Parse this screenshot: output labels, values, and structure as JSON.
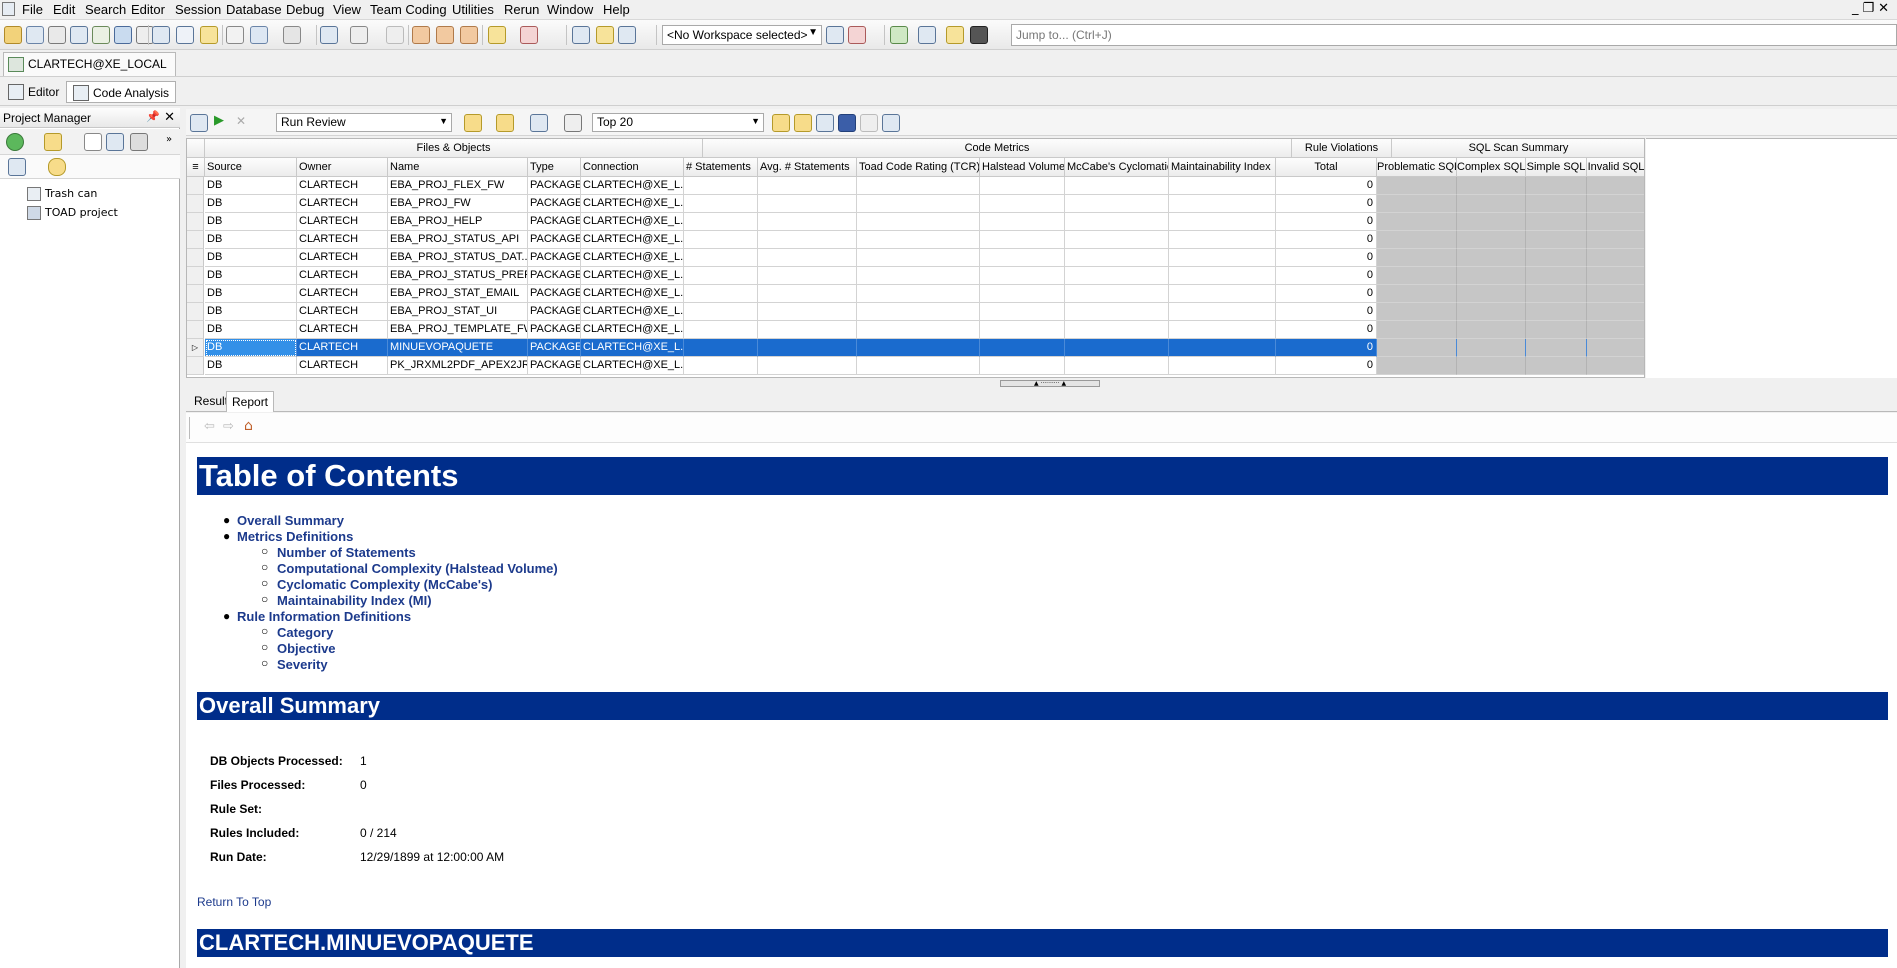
{
  "menu": [
    "File",
    "Edit",
    "Search",
    "Editor",
    "Session",
    "Database",
    "Debug",
    "View",
    "Team Coding",
    "Utilities",
    "Rerun",
    "Window",
    "Help"
  ],
  "toolbar": {
    "workspace": "<No Workspace selected>",
    "jump_placeholder": "Jump to... (Ctrl+J)"
  },
  "connection_tab": "CLARTECH@XE_LOCAL",
  "editor_tabs": [
    "Editor",
    "Code Analysis"
  ],
  "project_manager": {
    "title": "Project Manager",
    "items": [
      "Trash can",
      "TOAD project"
    ]
  },
  "review_toolbar": {
    "action": "Run Review",
    "top": "Top 20"
  },
  "grid": {
    "groups": [
      "Files & Objects",
      "Code Metrics",
      "Rule Violations",
      "SQL Scan Summary"
    ],
    "columns": [
      "Source",
      "Owner",
      "Name",
      "Type",
      "Connection",
      "# Statements",
      "Avg. # Statements",
      "Toad Code Rating (TCR)",
      "Halstead Volume",
      "McCabe's Cyclomatic",
      "Maintainability Index",
      "Total",
      "Problematic SQL",
      "Complex SQL",
      "Simple SQL",
      "Invalid SQL"
    ],
    "rows": [
      {
        "source": "DB",
        "owner": "CLARTECH",
        "name": "EBA_PROJ_FLEX_FW",
        "type": "PACKAGE",
        "conn": "CLARTECH@XE_L...",
        "total": "0"
      },
      {
        "source": "DB",
        "owner": "CLARTECH",
        "name": "EBA_PROJ_FW",
        "type": "PACKAGE",
        "conn": "CLARTECH@XE_L...",
        "total": "0"
      },
      {
        "source": "DB",
        "owner": "CLARTECH",
        "name": "EBA_PROJ_HELP",
        "type": "PACKAGE",
        "conn": "CLARTECH@XE_L...",
        "total": "0"
      },
      {
        "source": "DB",
        "owner": "CLARTECH",
        "name": "EBA_PROJ_STATUS_API",
        "type": "PACKAGE",
        "conn": "CLARTECH@XE_L...",
        "total": "0"
      },
      {
        "source": "DB",
        "owner": "CLARTECH",
        "name": "EBA_PROJ_STATUS_DAT...",
        "type": "PACKAGE",
        "conn": "CLARTECH@XE_L...",
        "total": "0"
      },
      {
        "source": "DB",
        "owner": "CLARTECH",
        "name": "EBA_PROJ_STATUS_PREF...",
        "type": "PACKAGE",
        "conn": "CLARTECH@XE_L...",
        "total": "0"
      },
      {
        "source": "DB",
        "owner": "CLARTECH",
        "name": "EBA_PROJ_STAT_EMAIL",
        "type": "PACKAGE",
        "conn": "CLARTECH@XE_L...",
        "total": "0"
      },
      {
        "source": "DB",
        "owner": "CLARTECH",
        "name": "EBA_PROJ_STAT_UI",
        "type": "PACKAGE",
        "conn": "CLARTECH@XE_L...",
        "total": "0"
      },
      {
        "source": "DB",
        "owner": "CLARTECH",
        "name": "EBA_PROJ_TEMPLATE_FW",
        "type": "PACKAGE",
        "conn": "CLARTECH@XE_L...",
        "total": "0"
      },
      {
        "source": "DB",
        "owner": "CLARTECH",
        "name": "MINUEVOPAQUETE",
        "type": "PACKAGE",
        "conn": "CLARTECH@XE_L...",
        "total": "0",
        "selected": true
      },
      {
        "source": "DB",
        "owner": "CLARTECH",
        "name": "PK_JRXML2PDF_APEX2JR...",
        "type": "PACKAGE",
        "conn": "CLARTECH@XE_L...",
        "total": "0"
      }
    ]
  },
  "result_tabs": [
    "Result",
    "Report"
  ],
  "report": {
    "toc_title": "Table of Contents",
    "toc": [
      {
        "label": "Overall Summary",
        "level": 1
      },
      {
        "label": "Metrics Definitions",
        "level": 1
      },
      {
        "label": "Number of Statements",
        "level": 2
      },
      {
        "label": "Computational Complexity (Halstead Volume)",
        "level": 2
      },
      {
        "label": "Cyclomatic Complexity (McCabe's)",
        "level": 2
      },
      {
        "label": "Maintainability Index (MI)",
        "level": 2
      },
      {
        "label": "Rule Information Definitions",
        "level": 1
      },
      {
        "label": "Category",
        "level": 2
      },
      {
        "label": "Objective",
        "level": 2
      },
      {
        "label": "Severity",
        "level": 2
      }
    ],
    "summary_title": "Overall Summary",
    "summary": [
      {
        "k": "DB Objects Processed:",
        "v": "1"
      },
      {
        "k": "Files Processed:",
        "v": "0"
      },
      {
        "k": "Rule Set:",
        "v": ""
      },
      {
        "k": "Rules Included:",
        "v": "0 / 214"
      },
      {
        "k": "Run Date:",
        "v": "12/29/1899 at 12:00:00 AM"
      }
    ],
    "return_top": "Return To Top",
    "object_title": "CLARTECH.MINUEVOPAQUETE"
  }
}
